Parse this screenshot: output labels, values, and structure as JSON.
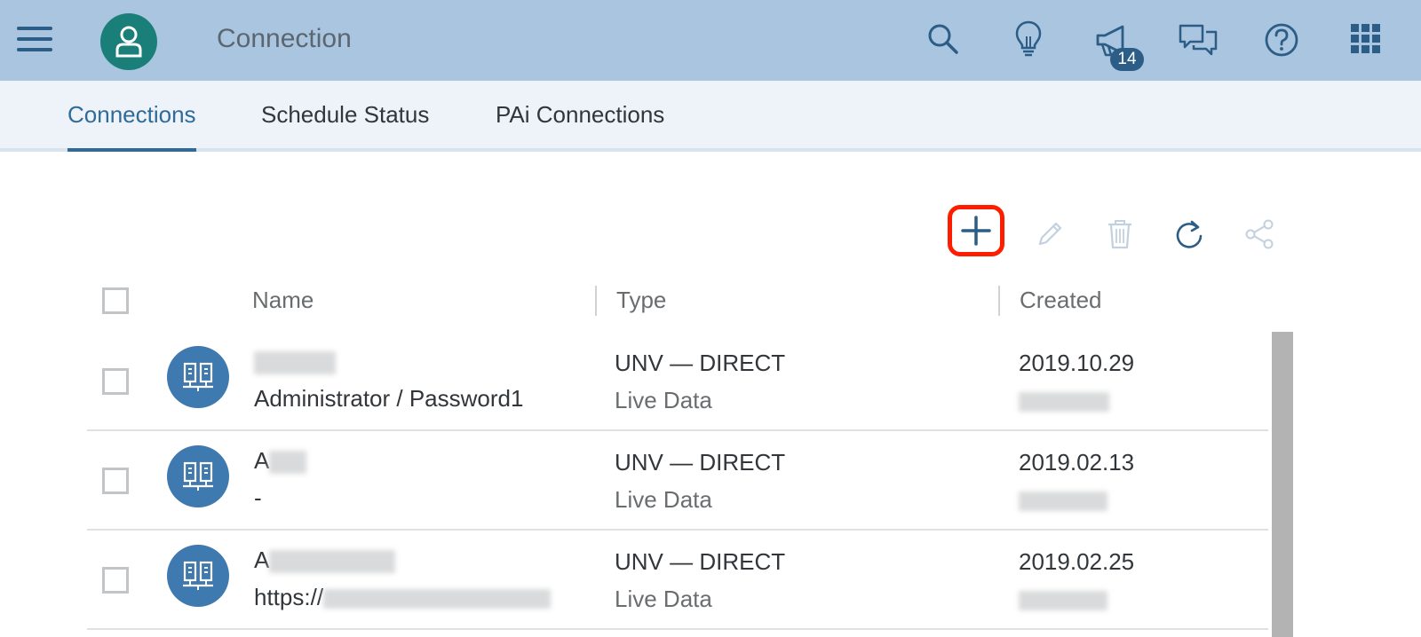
{
  "shell": {
    "title": "Connection",
    "notification_count": "14",
    "icons": [
      "menu-icon",
      "user-icon",
      "search-icon",
      "lightbulb-icon",
      "megaphone-icon",
      "feedback-icon",
      "help-icon",
      "app-grid-icon"
    ]
  },
  "tabs": [
    {
      "label": "Connections",
      "active": true
    },
    {
      "label": "Schedule Status",
      "active": false
    },
    {
      "label": "PAi Connections",
      "active": false
    }
  ],
  "toolbar": {
    "icons": [
      "add-icon",
      "edit-icon",
      "delete-icon",
      "refresh-icon",
      "share-icon"
    ],
    "highlight_color": "#ff1d00"
  },
  "table": {
    "columns": [
      "Name",
      "Type",
      "Created"
    ],
    "rows": [
      {
        "name_prefix": "",
        "detail": "Administrator / Password1",
        "type": "UNV — DIRECT",
        "type_detail": "Live Data",
        "created": "2019.10.29"
      },
      {
        "name_prefix": "A",
        "detail": "-",
        "type": "UNV — DIRECT",
        "type_detail": "Live Data",
        "created": "2019.02.13"
      },
      {
        "name_prefix": "A",
        "detail": "https://",
        "type": "UNV — DIRECT",
        "type_detail": "Live Data",
        "created": "2019.02.25"
      }
    ]
  },
  "colors": {
    "shell_background": "#a9c5df",
    "avatar": "#1a7f78",
    "active_tab": "#2f6b99",
    "row_icon": "#3e79af"
  }
}
